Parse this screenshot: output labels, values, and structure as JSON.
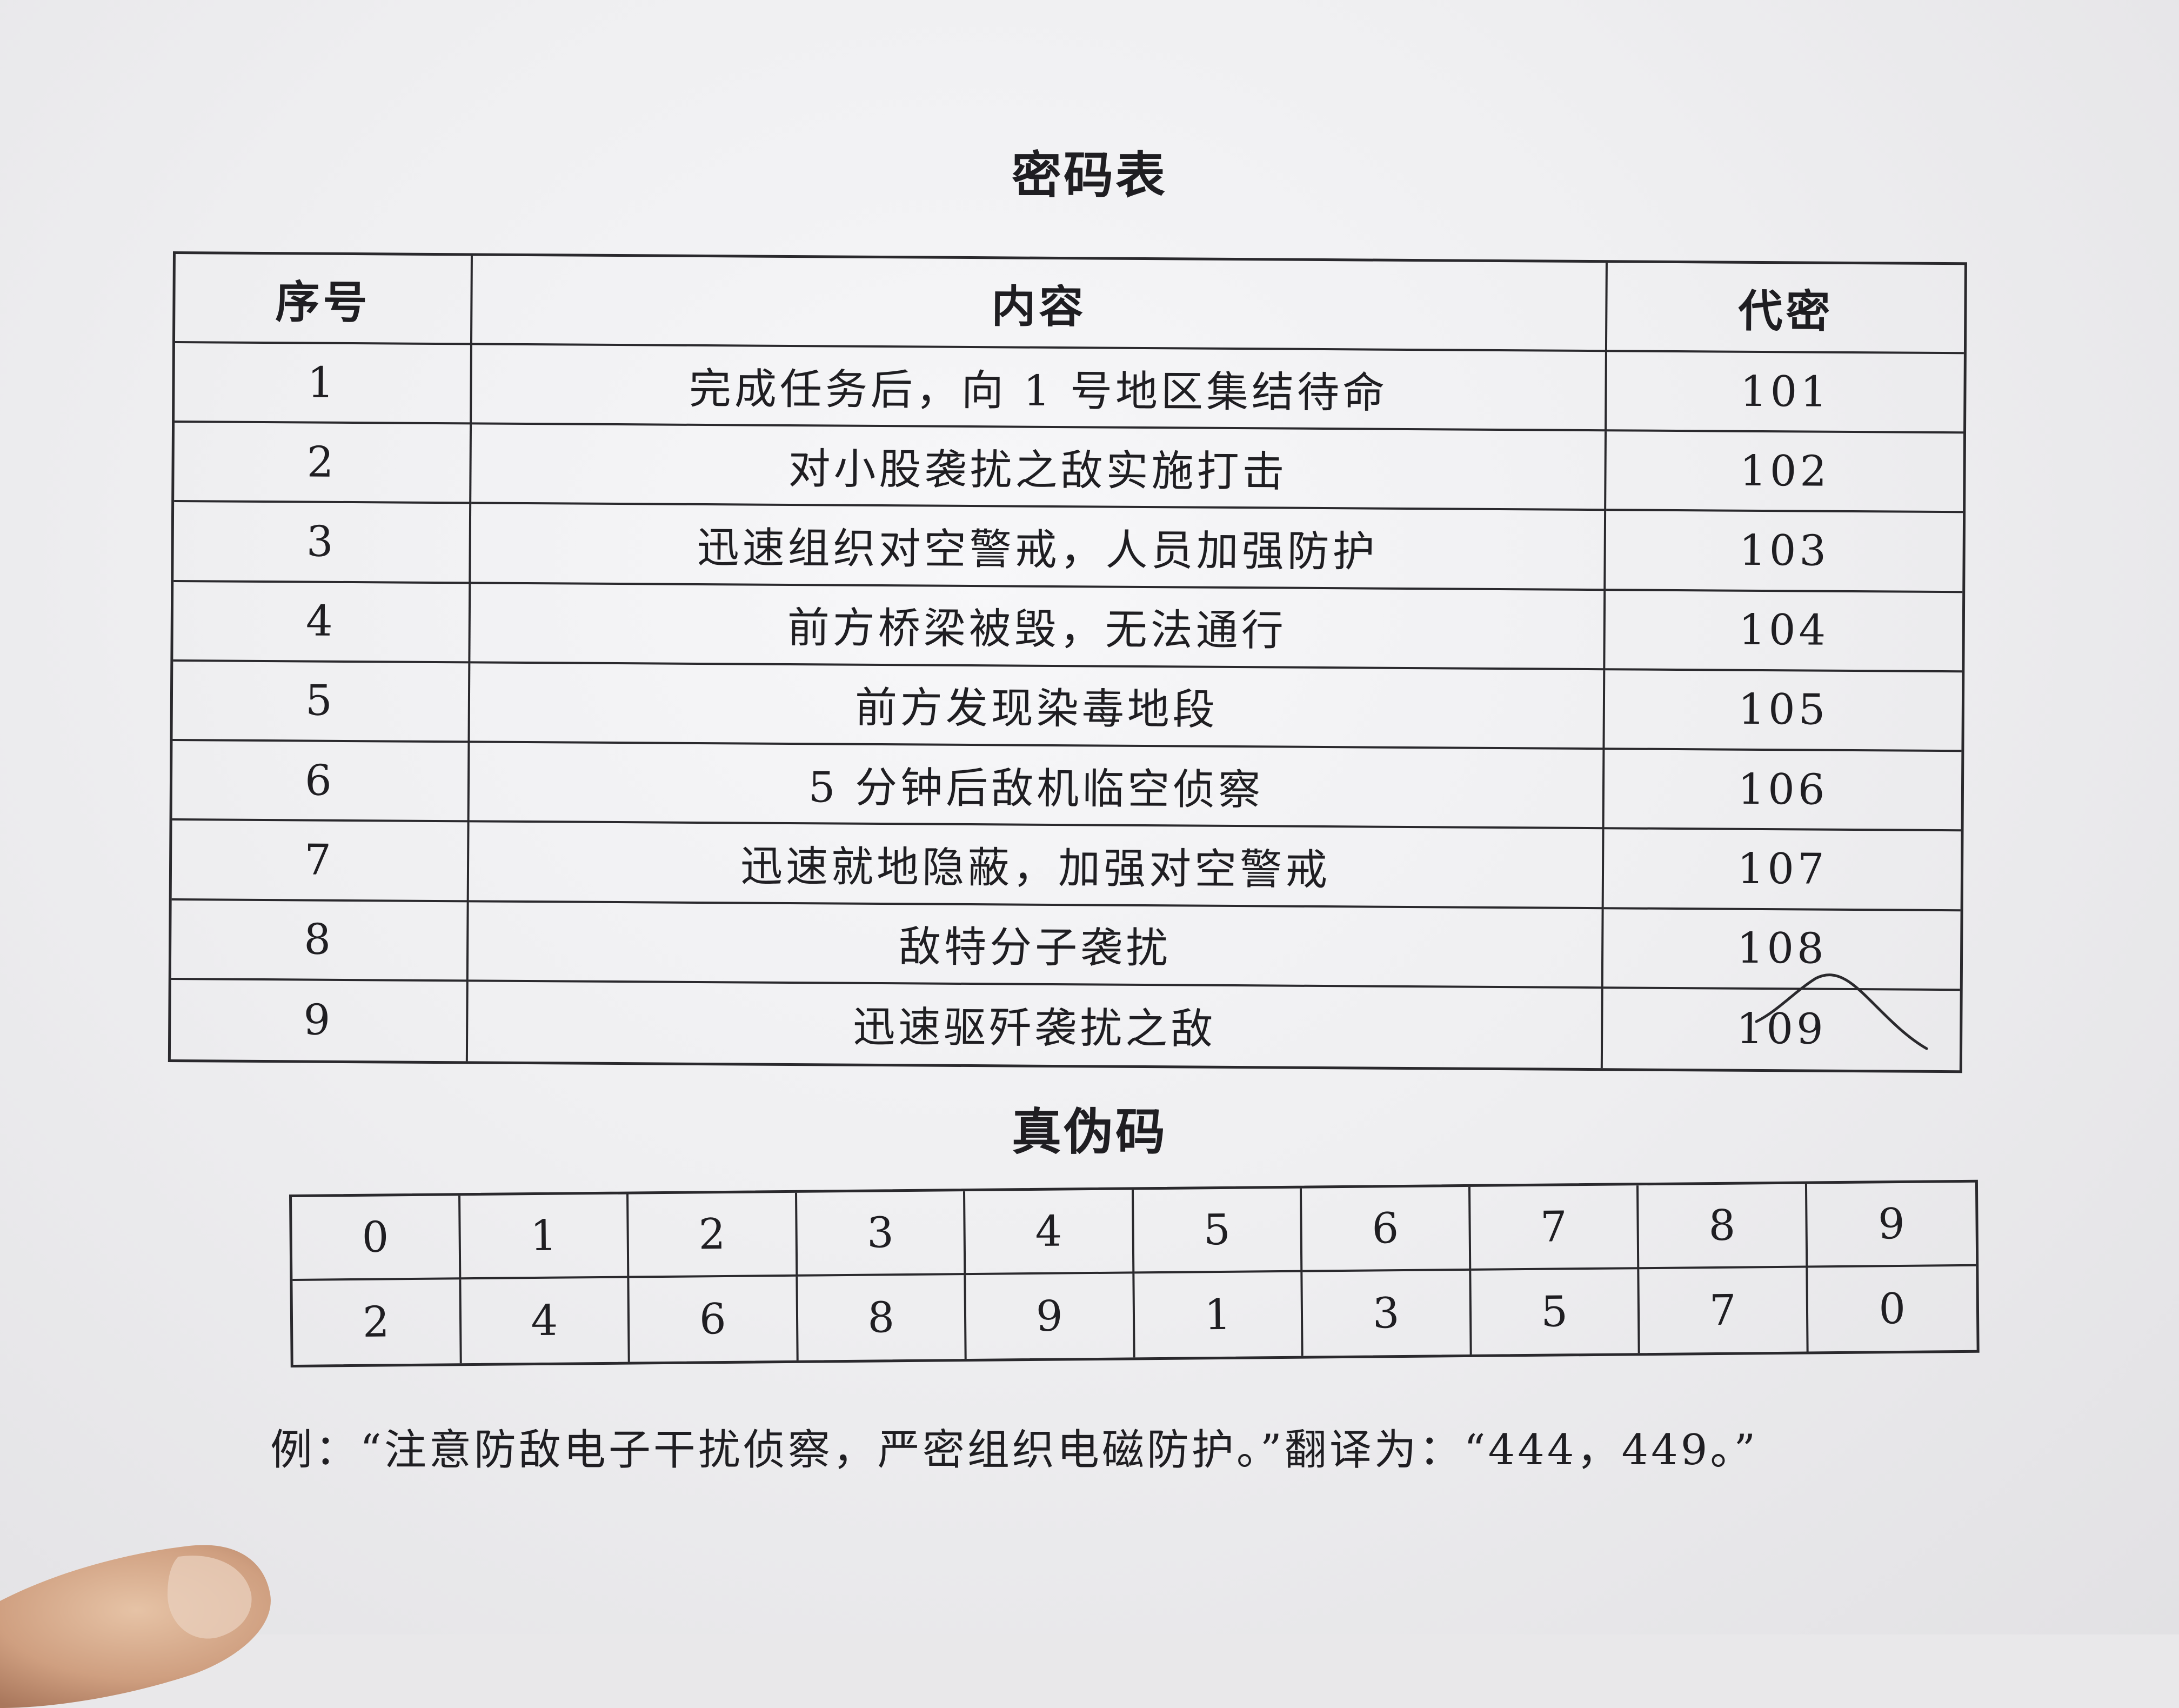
{
  "code_table": {
    "title": "密码表",
    "headers": [
      "序号",
      "内容",
      "代密"
    ],
    "rows": [
      {
        "index": "1",
        "content": "完成任务后，向 1 号地区集结待命",
        "code": "101"
      },
      {
        "index": "2",
        "content": "对小股袭扰之敌实施打击",
        "code": "102"
      },
      {
        "index": "3",
        "content": "迅速组织对空警戒，人员加强防护",
        "code": "103"
      },
      {
        "index": "4",
        "content": "前方桥梁被毁，无法通行",
        "code": "104"
      },
      {
        "index": "5",
        "content": "前方发现染毒地段",
        "code": "105"
      },
      {
        "index": "6",
        "content": "5 分钟后敌机临空侦察",
        "code": "106"
      },
      {
        "index": "7",
        "content": "迅速就地隐蔽，加强对空警戒",
        "code": "107"
      },
      {
        "index": "8",
        "content": "敌特分子袭扰",
        "code": "108"
      },
      {
        "index": "9",
        "content": "迅速驱歼袭扰之敌",
        "code": "109"
      }
    ]
  },
  "truth_table": {
    "title": "真伪码",
    "top": [
      "0",
      "1",
      "2",
      "3",
      "4",
      "5",
      "6",
      "7",
      "8",
      "9"
    ],
    "bottom": [
      "2",
      "4",
      "6",
      "8",
      "9",
      "1",
      "3",
      "5",
      "7",
      "0"
    ]
  },
  "example": {
    "text": "例：“注意防敌电子干扰侦察，严密组织电磁防护。”翻译为：“444，449。”"
  }
}
